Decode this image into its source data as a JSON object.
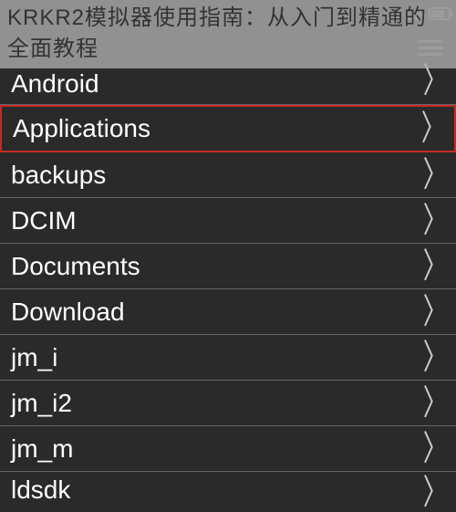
{
  "overlay_title": "KRKR2模拟器使用指南：从入门到精通的全面教程",
  "items": [
    {
      "label": "Android",
      "selected": false,
      "partial": "top"
    },
    {
      "label": "Applications",
      "selected": true,
      "partial": null
    },
    {
      "label": "backups",
      "selected": false,
      "partial": null
    },
    {
      "label": "DCIM",
      "selected": false,
      "partial": null
    },
    {
      "label": "Documents",
      "selected": false,
      "partial": null
    },
    {
      "label": "Download",
      "selected": false,
      "partial": null
    },
    {
      "label": "jm_i",
      "selected": false,
      "partial": null
    },
    {
      "label": "jm_i2",
      "selected": false,
      "partial": null
    },
    {
      "label": "jm_m",
      "selected": false,
      "partial": null
    },
    {
      "label": "ldsdk",
      "selected": false,
      "partial": "bottom"
    }
  ]
}
